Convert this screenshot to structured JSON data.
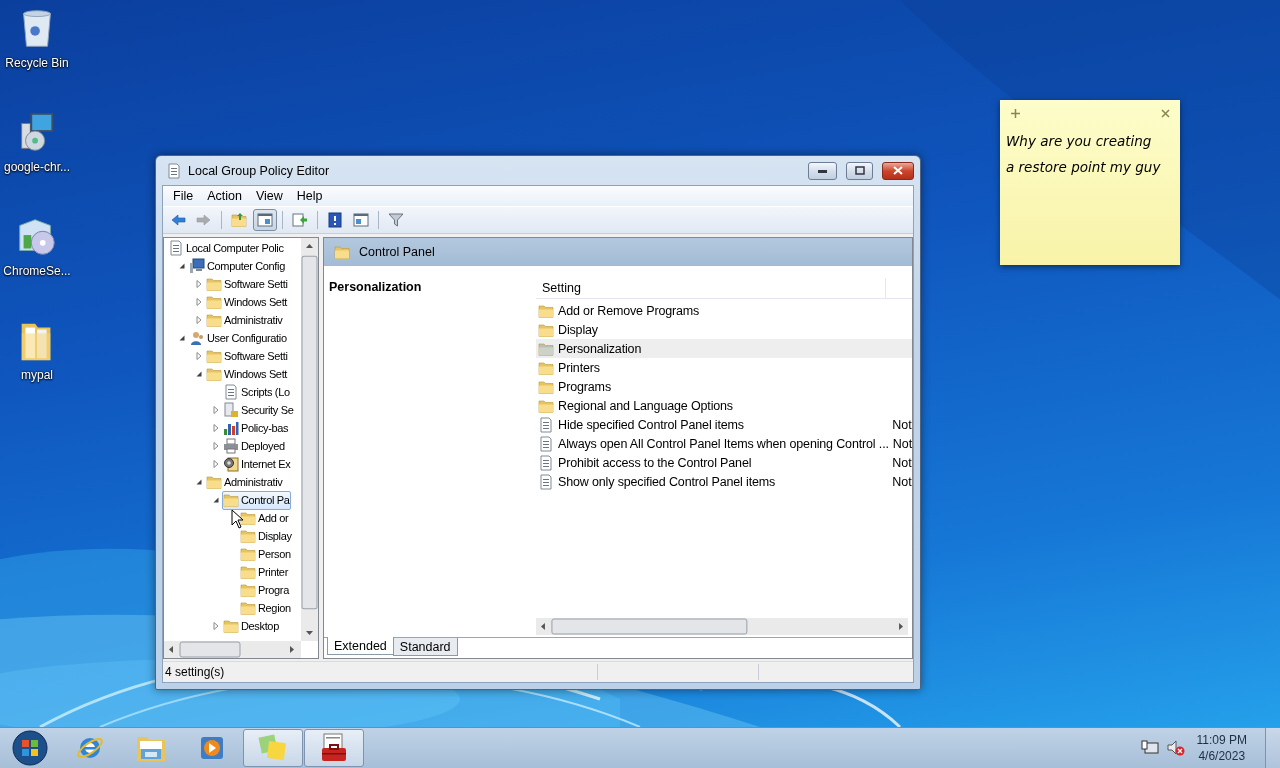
{
  "desktop_icons": [
    {
      "label": "Recycle Bin",
      "kind": "recycle"
    },
    {
      "label": "google-chr...",
      "kind": "installer"
    },
    {
      "label": "ChromeSe...",
      "kind": "setup"
    },
    {
      "label": "mypal",
      "kind": "folder"
    }
  ],
  "sticky_note": {
    "text": "Why are you creating a restore point my guy"
  },
  "window": {
    "title": "Local Group Policy Editor",
    "menu": [
      {
        "label": "File"
      },
      {
        "label": "Action"
      },
      {
        "label": "View"
      },
      {
        "label": "Help"
      }
    ],
    "toolbar": [
      {
        "kind": "back",
        "pressed": false,
        "disabled": false
      },
      {
        "kind": "forward",
        "pressed": false,
        "disabled": true
      },
      {
        "kind": "up",
        "pressed": false,
        "disabled": false
      },
      {
        "kind": "console-tree",
        "pressed": true,
        "disabled": false
      },
      {
        "kind": "export",
        "pressed": false,
        "disabled": false
      },
      {
        "kind": "help",
        "pressed": false,
        "disabled": false
      },
      {
        "kind": "action-pane",
        "pressed": false,
        "disabled": false
      },
      {
        "kind": "filter",
        "pressed": false,
        "disabled": false
      }
    ],
    "tree": [
      {
        "label": "Local Computer Polic",
        "kind": "policy",
        "selected": false,
        "children": [
          {
            "label": "Computer Config",
            "kind": "computer",
            "expanded": true,
            "selected": false,
            "children": [
              {
                "label": "Software Setti",
                "expanded": false,
                "selected": false
              },
              {
                "label": "Windows Sett",
                "expanded": false,
                "selected": false
              },
              {
                "label": "Administrativ",
                "expanded": false,
                "selected": false
              }
            ]
          },
          {
            "label": "User Configuratio",
            "kind": "user",
            "expanded": true,
            "selected": false,
            "children": [
              {
                "label": "Software Setti",
                "expanded": false,
                "selected": false
              },
              {
                "label": "Windows Sett",
                "expanded": true,
                "selected": false,
                "children": [
                  {
                    "label": "Scripts (Lo",
                    "kind": "script",
                    "selected": false
                  },
                  {
                    "label": "Security Se",
                    "kind": "security",
                    "expanded": false,
                    "selected": false
                  },
                  {
                    "label": "Policy-bas",
                    "kind": "chart",
                    "expanded": false,
                    "selected": false
                  },
                  {
                    "label": "Deployed",
                    "kind": "printer",
                    "expanded": false,
                    "selected": false
                  },
                  {
                    "label": "Internet Ex",
                    "kind": "internet",
                    "expanded": false,
                    "selected": false
                  }
                ]
              },
              {
                "label": "Administrativ",
                "expanded": true,
                "selected": false,
                "children": [
                  {
                    "label": "Control Pa",
                    "expanded": true,
                    "selected": true,
                    "children": [
                      {
                        "label": "Add or",
                        "selected": false
                      },
                      {
                        "label": "Display",
                        "selected": false
                      },
                      {
                        "label": "Person",
                        "selected": false
                      },
                      {
                        "label": "Printer",
                        "selected": false
                      },
                      {
                        "label": "Progra",
                        "selected": false
                      },
                      {
                        "label": "Region",
                        "selected": false
                      }
                    ]
                  },
                  {
                    "label": "Desktop",
                    "expanded": false,
                    "selected": false
                  }
                ]
              }
            ]
          }
        ]
      }
    ],
    "header": "Control Panel",
    "description_title": "Personalization",
    "columns": [
      {
        "label": "Setting"
      }
    ],
    "rows": [
      {
        "name": "Add or Remove Programs",
        "kind": "folder",
        "selected": false
      },
      {
        "name": "Display",
        "kind": "folder",
        "selected": false
      },
      {
        "name": "Personalization",
        "kind": "folder",
        "selected": true
      },
      {
        "name": "Printers",
        "kind": "folder",
        "selected": false
      },
      {
        "name": "Programs",
        "kind": "folder",
        "selected": false
      },
      {
        "name": "Regional and Language Options",
        "kind": "folder",
        "selected": false
      },
      {
        "name": "Hide specified Control Panel items",
        "kind": "setting",
        "selected": false,
        "state": "Not"
      },
      {
        "name": "Always open All Control Panel Items when opening Control ...",
        "kind": "setting",
        "selected": false,
        "state": "Not"
      },
      {
        "name": "Prohibit access to the Control Panel",
        "kind": "setting",
        "selected": false,
        "state": "Not"
      },
      {
        "name": "Show only specified Control Panel items",
        "kind": "setting",
        "selected": false,
        "state": "Not"
      }
    ],
    "tabs": [
      {
        "label": "Extended",
        "selected": true
      },
      {
        "label": "Standard",
        "selected": false
      }
    ],
    "status_bar": "4 setting(s)"
  },
  "taskbar": {
    "items": [
      {
        "kind": "browser",
        "active": false
      },
      {
        "kind": "explorer",
        "active": false
      },
      {
        "kind": "media",
        "active": false
      },
      {
        "kind": "notes",
        "active": true
      },
      {
        "kind": "policy",
        "active": true
      }
    ],
    "time": "11:09 PM",
    "date": "4/6/2023"
  }
}
